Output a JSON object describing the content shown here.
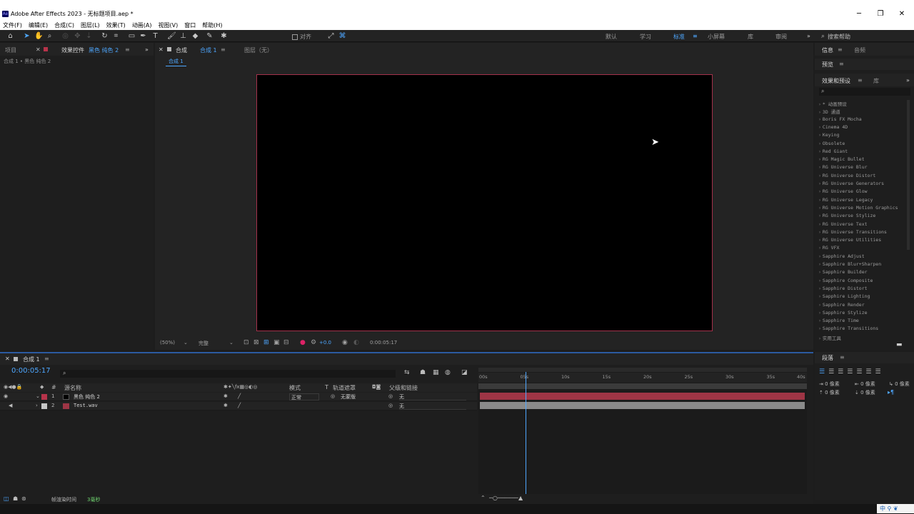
{
  "window": {
    "app_icon": "Ae",
    "title": "Adobe After Effects 2023 - 无标题项目.aep *",
    "controls": [
      "─",
      "❐",
      "✕"
    ]
  },
  "menu": [
    "文件(F)",
    "编辑(E)",
    "合成(C)",
    "图层(L)",
    "效果(T)",
    "动画(A)",
    "视图(V)",
    "窗口",
    "帮助(H)"
  ],
  "toolbar": {
    "align_label": "对齐",
    "workspaces": [
      "默认",
      "学习",
      "标准",
      "小屏幕",
      "库",
      "审阅"
    ],
    "active_workspace": "标准",
    "search_placeholder": "搜索帮助"
  },
  "left_panel": {
    "tab_project": "项目",
    "tab_effects": "效果控件",
    "tab_effects_target": "黑色 纯色 2",
    "breadcrumb": "合成 1 • 黑色 纯色 2"
  },
  "comp_panel": {
    "tab_comp": "合成",
    "tab_comp_name": "合成 1",
    "tab_layer": "图层（无）",
    "subtab": "合成 1",
    "zoom": "(50%)",
    "quality": "完整",
    "exposure": "+0.0",
    "timecode": "0:00:05:17"
  },
  "right_panel": {
    "tab_info": "信息",
    "tab_audio": "音频",
    "tab_preview": "预览",
    "tab_effects_presets": "效果和预设",
    "tab_library": "库",
    "search_icon": "search-icon",
    "effects": [
      "* 动画预设",
      "3D 通道",
      "Boris FX Mocha",
      "Cinema 4D",
      "Keying",
      "Obsolete",
      "Red Giant",
      "RG Magic Bullet",
      "RG Universe Blur",
      "RG Universe Distort",
      "RG Universe Generators",
      "RG Universe Glow",
      "RG Universe Legacy",
      "RG Universe Motion Graphics",
      "RG Universe Stylize",
      "RG Universe Text",
      "RG Universe Transitions",
      "RG Universe Utilities",
      "RG VFX",
      "Sapphire Adjust",
      "Sapphire Blur+Sharpen",
      "Sapphire Builder",
      "Sapphire Composite",
      "Sapphire Distort",
      "Sapphire Lighting",
      "Sapphire Render",
      "Sapphire Stylize",
      "Sapphire Time",
      "Sapphire Transitions",
      "实用工具"
    ]
  },
  "timeline": {
    "tab": "合成 1",
    "timecode": "0:00:05:17",
    "columns": {
      "source": "源名称",
      "mode": "模式",
      "t": "T",
      "track_matte": "轨道遮罩",
      "parent": "父级和链接"
    },
    "layers": [
      {
        "num": "1",
        "name": "黑色 纯色 2",
        "mode": "正常",
        "matte": "无蒙版",
        "parent": "无",
        "label_color": "#b7334a",
        "bar_color": "#9e3545"
      },
      {
        "num": "2",
        "name": "Test.wav",
        "mode": "",
        "matte": "",
        "parent": "无",
        "label_color": "#c7c7c7",
        "bar_color": "#8a8a8a"
      }
    ],
    "ruler": [
      "00s",
      "05s",
      "10s",
      "15s",
      "20s",
      "25s",
      "30s",
      "35s",
      "40s"
    ],
    "render_time_label": "帧渲染时间",
    "render_time_value": "3毫秒",
    "playhead_seconds": 5.71
  },
  "para_panel": {
    "tab": "段落",
    "indent_values": [
      "0 像素",
      "0 像素",
      "0 像素",
      "0 像素",
      "0 像素"
    ]
  },
  "taskbar": {
    "ime": "中"
  }
}
